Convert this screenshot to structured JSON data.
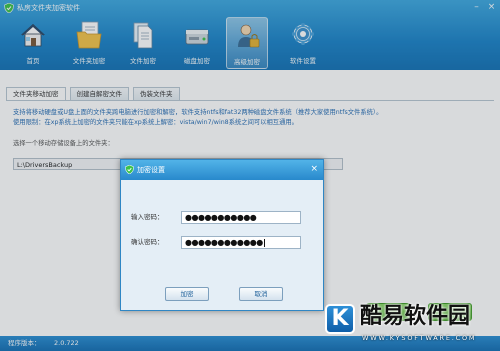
{
  "app": {
    "title": "私房文件夹加密软件",
    "version_label": "程序版本：",
    "version": "2.0.722",
    "colors": {
      "accent": "#1c83c8",
      "green": "#4fae2e"
    }
  },
  "toolbar": {
    "items": [
      {
        "label": "首页",
        "icon": "house-icon"
      },
      {
        "label": "文件夹加密",
        "icon": "folder-doc-icon"
      },
      {
        "label": "文件加密",
        "icon": "file-icon"
      },
      {
        "label": "磁盘加密",
        "icon": "disk-icon"
      },
      {
        "label": "高级加密",
        "icon": "user-lock-icon",
        "active": true
      },
      {
        "label": "软件设置",
        "icon": "gear-icon"
      }
    ]
  },
  "tabs": [
    {
      "label": "文件夹移动加密",
      "active": true
    },
    {
      "label": "创建自解密文件"
    },
    {
      "label": "伪装文件夹"
    }
  ],
  "main": {
    "desc1": "支持将移动硬盘或U盘上面的文件夹跨电脑进行加密和解密，软件支持ntfs和fat32两种磁盘文件系统（推荐大家使用ntfs文件系统）。",
    "desc2": "使用限制：在xp系统上加密的文件夹只能在xp系统上解密：vista/win7/win8系统之间可以相互通用。",
    "select_label": "选择一个移动存储设备上的文件夹：",
    "path": "L:\\DriversBackup"
  },
  "dialog": {
    "title": "加密设置",
    "password_label": "输入密码：",
    "password_value": "●●●●●●●●●●●",
    "confirm_label": "确认密码：",
    "confirm_value": "●●●●●●●●●●●●",
    "ok_label": "加密",
    "cancel_label": "取消"
  },
  "watermark": {
    "icon_letter": "K",
    "text": "酷易软件园",
    "url": "WWW.KYSOFTWARE.COM"
  }
}
